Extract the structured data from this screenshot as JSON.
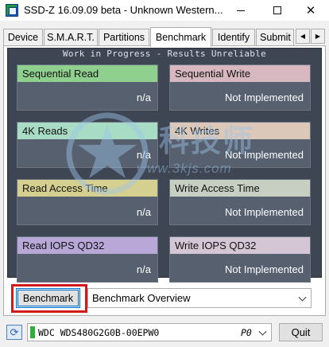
{
  "window": {
    "title": "SSD-Z 16.09.09 beta - Unknown Western...",
    "controls": {
      "minimize": "—",
      "maximize": "☐",
      "close": "✕"
    }
  },
  "tabs": [
    {
      "label": "Device"
    },
    {
      "label": "S.M.A.R.T."
    },
    {
      "label": "Partitions"
    },
    {
      "label": "Benchmark",
      "active": true
    },
    {
      "label": "Identify"
    },
    {
      "label": "Submit"
    }
  ],
  "tab_scroll": {
    "left": "◀",
    "right": "▶"
  },
  "benchmark": {
    "banner": "Work in Progress - Results Unreliable",
    "metrics": [
      {
        "label": "Sequential Read",
        "value": "n/a",
        "color": "#8fd08f"
      },
      {
        "label": "Sequential Write",
        "value": "Not Implemented",
        "color": "#d8b8c0"
      },
      {
        "label": "4K Reads",
        "value": "n/a",
        "color": "#a8dcc4"
      },
      {
        "label": "4K Writes",
        "value": "Not Implemented",
        "color": "#dbc8b8"
      },
      {
        "label": "Read Access Time",
        "value": "n/a",
        "color": "#d6d090"
      },
      {
        "label": "Write Access Time",
        "value": "Not Implemented",
        "color": "#c6cfc2"
      },
      {
        "label": "Read IOPS QD32",
        "value": "n/a",
        "color": "#b7a8d8"
      },
      {
        "label": "Write IOPS QD32",
        "value": "Not Implemented",
        "color": "#d4c6d4"
      }
    ],
    "run_button": "Benchmark",
    "mode_select": "Benchmark Overview"
  },
  "watermark": {
    "text": "科技师",
    "url": "www.3kjs.com"
  },
  "status": {
    "drive": "WDC WDS480G2G0B-00EPW0",
    "port": "P0",
    "quit": "Quit",
    "refresh_icon": "⟳"
  },
  "colors": {
    "panel": "#3e4553",
    "tile": "#56606f",
    "highlight": "#d11a1a",
    "focus": "#0078d7"
  }
}
